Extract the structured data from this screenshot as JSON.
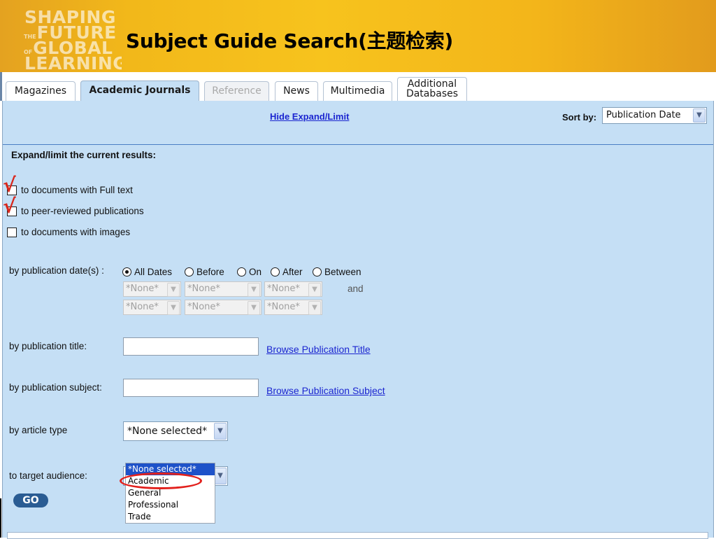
{
  "logo": {
    "lines": [
      {
        "prefix": "",
        "text": "SHAPING"
      },
      {
        "prefix": "THE",
        "text": "FUTURE"
      },
      {
        "prefix": "OF",
        "text": "GLOBAL"
      },
      {
        "prefix": "",
        "text": "LEARNING"
      }
    ]
  },
  "page_title": "Subject Guide Search(主题检索)",
  "tabs": [
    {
      "label": "Magazines",
      "state": "normal"
    },
    {
      "label": "Academic Journals",
      "state": "active"
    },
    {
      "label": "Reference",
      "state": "disabled"
    },
    {
      "label": "News",
      "state": "normal"
    },
    {
      "label": "Multimedia",
      "state": "normal"
    },
    {
      "label_line1": "Additional",
      "label_line2": "Databases",
      "state": "normal"
    }
  ],
  "toolbar": {
    "hide_link": "Hide Expand/Limit",
    "sort_label": "Sort by:",
    "sort_value": "Publication Date"
  },
  "expand": {
    "heading": "Expand/limit the current results:",
    "options": [
      {
        "label": "to documents with Full text",
        "annotated_check": true
      },
      {
        "label": "to peer-reviewed publications",
        "annotated_check": true
      },
      {
        "label": "to documents with images",
        "annotated_check": false
      }
    ],
    "check_glyph": "√"
  },
  "date_filter": {
    "label": "by publication date(s) :",
    "radios": [
      {
        "label": "All Dates",
        "checked": true
      },
      {
        "label": "Before",
        "checked": false
      },
      {
        "label": "On",
        "checked": false
      },
      {
        "label": "After",
        "checked": false
      },
      {
        "label": "Between",
        "checked": false
      }
    ],
    "none_text": "*None*",
    "and_text": "and"
  },
  "title_filter": {
    "label": "by publication title:",
    "value": "",
    "browse_link": "Browse Publication Title"
  },
  "subject_filter": {
    "label": "by publication subject:",
    "value": "",
    "browse_link": "Browse Publication Subject"
  },
  "article_type": {
    "label": "by article type",
    "value": "*None selected*"
  },
  "audience": {
    "label": "to target audience:",
    "options": [
      "*None selected*",
      "Academic",
      "General",
      "Professional",
      "Trade"
    ],
    "selected_index": 0,
    "highlighted_option": "Academic"
  },
  "go_button": "GO",
  "colors": {
    "accent_red": "#e2201c",
    "panel": "#c5dff5",
    "link": "#1b25d0",
    "banner": "#f7c31d"
  }
}
